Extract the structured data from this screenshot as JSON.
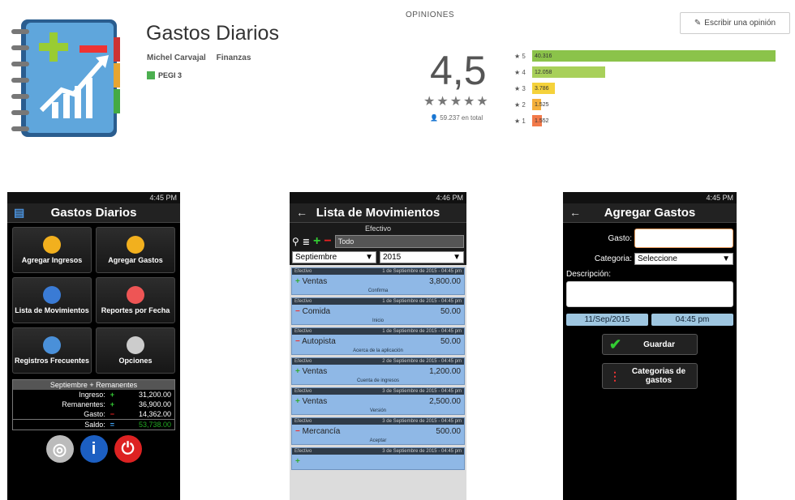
{
  "app": {
    "title": "Gastos Diarios",
    "developer": "Michel Carvajal",
    "category": "Finanzas",
    "pegi": "PEGI 3"
  },
  "reviews": {
    "section_label": "OPINIONES",
    "write_button": "Escribir una opinión",
    "score": "4,5",
    "stars": "★★★★★",
    "total": "59.237 en total",
    "bars": [
      {
        "label": "★ 5",
        "count": "40.316",
        "value": 40316,
        "color": "#8bc34a"
      },
      {
        "label": "★ 4",
        "count": "12.058",
        "value": 12058,
        "color": "#a8d05a"
      },
      {
        "label": "★ 3",
        "count": "3.786",
        "value": 3786,
        "color": "#f5d23b"
      },
      {
        "label": "★ 2",
        "count": "1.525",
        "value": 1525,
        "color": "#f5b03b"
      },
      {
        "label": "★ 1",
        "count": "1.552",
        "value": 1552,
        "color": "#f27a4a"
      }
    ]
  },
  "phone1": {
    "status": "4:45 PM",
    "title": "Gastos Diarios",
    "tiles": [
      {
        "label": "Agregar Ingresos",
        "icon": "add-income-icon",
        "color": "#f2b01e"
      },
      {
        "label": "Agregar Gastos",
        "icon": "add-expense-icon",
        "color": "#f2b01e"
      },
      {
        "label": "Lista de Movimientos",
        "icon": "list-icon",
        "color": "#3a7bd5"
      },
      {
        "label": "Reportes por Fecha",
        "icon": "chart-icon",
        "color": "#e55"
      },
      {
        "label": "Registros Frecuentes",
        "icon": "calendar-icon",
        "color": "#4a90d9"
      },
      {
        "label": "Opciones",
        "icon": "gear-icon",
        "color": "#ccc"
      }
    ],
    "summary": {
      "header": "Septiembre + Remanentes",
      "rows": [
        {
          "k": "Ingreso:",
          "v": "31,200.00"
        },
        {
          "k": "Remanentes:",
          "v": "36,900.00"
        },
        {
          "k": "Gasto:",
          "v": "14,362.00"
        },
        {
          "k": "Saldo:",
          "v": "53,738.00"
        }
      ]
    }
  },
  "phone2": {
    "status": "4:46 PM",
    "title": "Lista de Movimientos",
    "account": "Efectivo",
    "filter": "Todo",
    "month": "Septiembre",
    "year": "2015",
    "movements": [
      {
        "acct": "Efectivo",
        "date": "1 de Septiembre de 2015 - 04:45 pm",
        "name": "Ventas",
        "amount": "3,800.00",
        "note": "Confirma",
        "type": "in"
      },
      {
        "acct": "Efectivo",
        "date": "1 de Septiembre de 2015 - 04:45 pm",
        "name": "Comida",
        "amount": "50.00",
        "note": "Inicio",
        "type": "out"
      },
      {
        "acct": "Efectivo",
        "date": "1 de Septiembre de 2015 - 04:45 pm",
        "name": "Autopista",
        "amount": "50.00",
        "note": "Acerca de la aplicación",
        "type": "out"
      },
      {
        "acct": "Efectivo",
        "date": "2 de Septiembre de 2015 - 04:45 pm",
        "name": "Ventas",
        "amount": "1,200.00",
        "note": "Cuenta de ingresos",
        "type": "in"
      },
      {
        "acct": "Efectivo",
        "date": "3 de Septiembre de 2015 - 04:45 pm",
        "name": "Ventas",
        "amount": "2,500.00",
        "note": "Versión",
        "type": "in"
      },
      {
        "acct": "Efectivo",
        "date": "3 de Septiembre de 2015 - 04:45 pm",
        "name": "Mercancía",
        "amount": "500.00",
        "note": "Aceptar",
        "type": "out"
      },
      {
        "acct": "Efectivo",
        "date": "3 de Septiembre de 2015 - 04:45 pm",
        "name": "",
        "amount": "",
        "note": "",
        "type": "in"
      }
    ]
  },
  "phone3": {
    "status": "4:45 PM",
    "title": "Agregar Gastos",
    "gasto_label": "Gasto:",
    "categoria_label": "Categoria:",
    "categoria_value": "Seleccione",
    "descripcion_label": "Descripción:",
    "date": "11/Sep/2015",
    "time": "04:45 pm",
    "save_label": "Guardar",
    "categories_label": "Categorias de gastos"
  }
}
